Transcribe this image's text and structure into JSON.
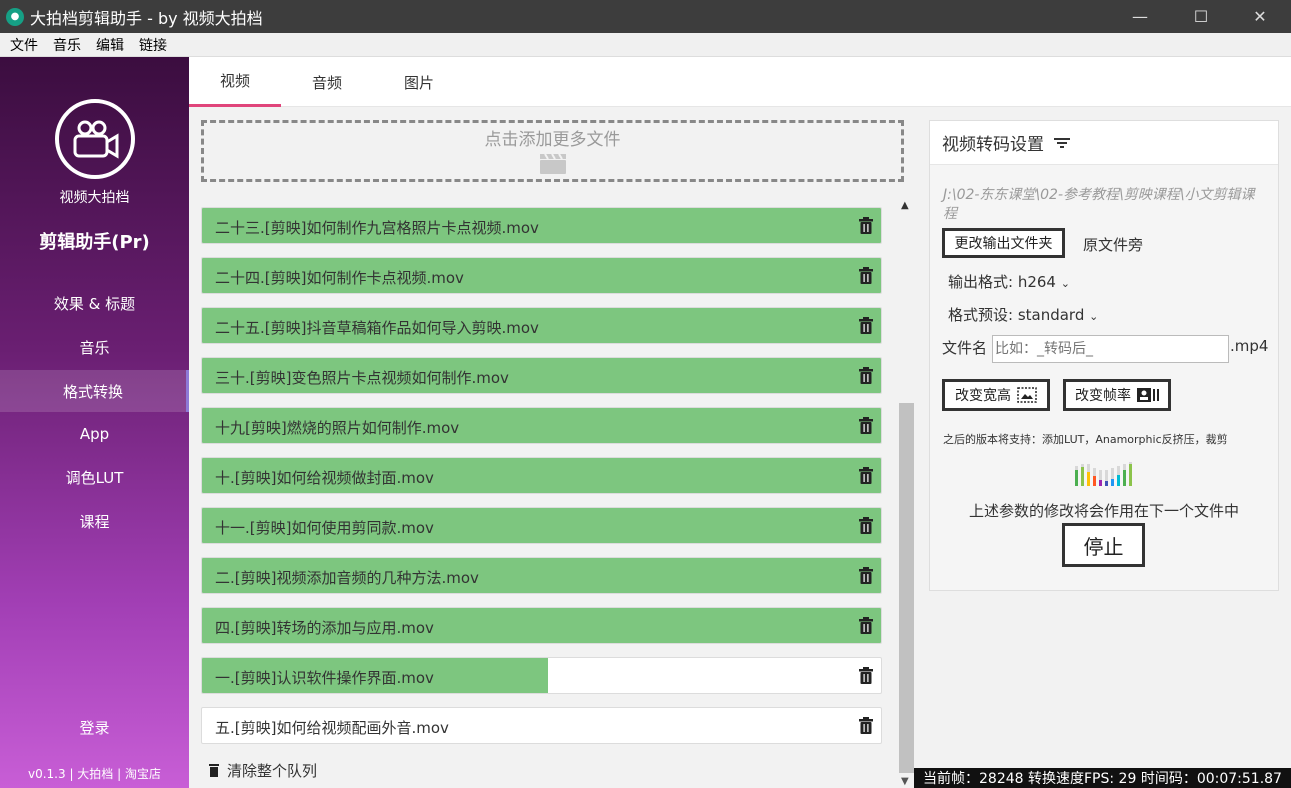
{
  "window": {
    "title": "大拍档剪辑助手 - by 视频大拍档",
    "min_label": "—",
    "max_label": "☐",
    "close_label": "✕"
  },
  "menu": [
    "文件",
    "音乐",
    "编辑",
    "链接"
  ],
  "sidebar": {
    "brand_line1": "视频大拍档",
    "brand_line2": "剪辑助手(Pr)",
    "items": [
      {
        "label": "效果 & 标题"
      },
      {
        "label": "音乐"
      },
      {
        "label": "格式转换"
      },
      {
        "label": "App"
      },
      {
        "label": "调色LUT"
      },
      {
        "label": "课程"
      }
    ],
    "active_index": 2,
    "login": "登录",
    "version": "v0.1.3 | 大拍档 | 淘宝店"
  },
  "tabs": [
    {
      "label": "视频"
    },
    {
      "label": "音频"
    },
    {
      "label": "图片"
    }
  ],
  "active_tab": 0,
  "dropzone": {
    "label": "点击添加更多文件"
  },
  "files": [
    {
      "name": "二十三.[剪映]如何制作九宫格照片卡点视频.mov",
      "progress": 1.0
    },
    {
      "name": "二十四.[剪映]如何制作卡点视频.mov",
      "progress": 1.0
    },
    {
      "name": "二十五.[剪映]抖音草稿箱作品如何导入剪映.mov",
      "progress": 1.0
    },
    {
      "name": "三十.[剪映]变色照片卡点视频如何制作.mov",
      "progress": 1.0
    },
    {
      "name": "十九[剪映]燃烧的照片如何制作.mov",
      "progress": 1.0
    },
    {
      "name": "十.[剪映]如何给视频做封面.mov",
      "progress": 1.0
    },
    {
      "name": "十一.[剪映]如何使用剪同款.mov",
      "progress": 1.0
    },
    {
      "name": "二.[剪映]视频添加音频的几种方法.mov",
      "progress": 1.0
    },
    {
      "name": "四.[剪映]转场的添加与应用.mov",
      "progress": 1.0
    },
    {
      "name": "一.[剪映]认识软件操作界面.mov",
      "progress": 0.51
    },
    {
      "name": "五.[剪映]如何给视频配画外音.mov",
      "progress": 0.0
    }
  ],
  "clear_queue": "清除整个队列",
  "settings": {
    "title": "视频转码设置",
    "output_path": "J:\\02-东东课堂\\02-参考教程\\剪映课程\\小文剪辑课程",
    "change_folder": "更改输出文件夹",
    "original_folder": "原文件旁",
    "output_format": "输出格式: h264",
    "format_preset": "格式预设: standard",
    "filename_label": "文件名",
    "filename_placeholder": "比如：_转码后_",
    "extension": ".mp4",
    "change_size": "改变宽高",
    "change_fps": "改变帧率",
    "future_note": "之后的版本将支持：添加LUT，Anamorphic反挤压，裁剪",
    "apply_note": "上述参数的修改将会作用在下一个文件中",
    "stop": "停止"
  },
  "status": "当前帧：28248 转换速度FPS: 29 时间码：00:07:51.87",
  "colors": {
    "progress": "#7dc67f",
    "tab_accent": "#e0457b",
    "sidebar_top": "#3b0d3f",
    "sidebar_bottom": "#c85ed6"
  }
}
